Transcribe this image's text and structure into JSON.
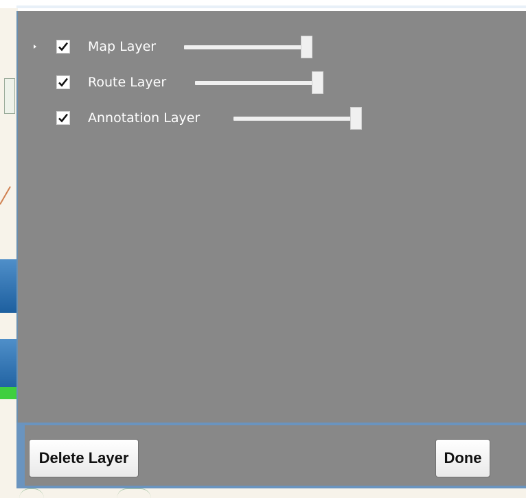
{
  "layers": [
    {
      "label": "Map Layer",
      "checked": true,
      "opacity": 1.0,
      "expandable": true
    },
    {
      "label": "Route Layer",
      "checked": true,
      "opacity": 1.0,
      "expandable": false
    },
    {
      "label": "Annotation Layer",
      "checked": true,
      "opacity": 1.0,
      "expandable": false
    }
  ],
  "buttons": {
    "delete_label": "Delete Layer",
    "done_label": "Done"
  },
  "icons": {
    "expander": "chevron-right-icon",
    "checkbox": "check-icon"
  },
  "colors": {
    "panel_background": "#888888",
    "frame_accent": "#6a94bf",
    "label_text": "#ffffff"
  }
}
